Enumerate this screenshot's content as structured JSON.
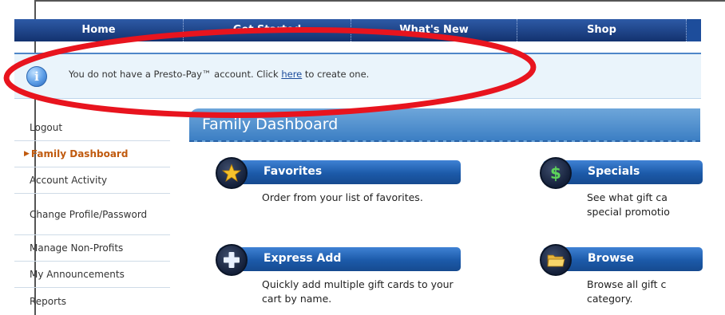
{
  "nav": {
    "items": [
      "Home",
      "Get Started",
      "What's New",
      "Shop",
      ""
    ]
  },
  "banner": {
    "prefix": "You do not have a Presto-Pay™ account. Click ",
    "link": "here",
    "suffix": " to create one.",
    "icon": "info-icon"
  },
  "sidebar": {
    "items": [
      {
        "label": "Logout"
      },
      {
        "label": "Family Dashboard",
        "active": true
      },
      {
        "label": "Account Activity"
      },
      {
        "label": "Change Profile/Password"
      },
      {
        "label": "Manage Non-Profits"
      },
      {
        "label": "My Announcements"
      },
      {
        "label": "Reports"
      }
    ]
  },
  "main": {
    "title": "Family Dashboard",
    "features": [
      {
        "label": "Favorites",
        "icon": "star-icon",
        "desc": "Order from your list of favorites."
      },
      {
        "label": "Specials",
        "icon": "dollar-icon",
        "desc_line1": "See what gift ca",
        "desc_line2": "special promotio"
      },
      {
        "label": "Express Add",
        "icon": "plus-icon",
        "desc": "Quickly add multiple gift cards to your cart by name."
      },
      {
        "label": "Browse",
        "icon": "folder-icon",
        "desc_line1": "Browse all gift c",
        "desc_line2": "category."
      }
    ]
  },
  "colors": {
    "nav": "#13326f",
    "banner_bg": "#eaf4fb",
    "active": "#c05a0e",
    "annotation": "#e8141e"
  }
}
